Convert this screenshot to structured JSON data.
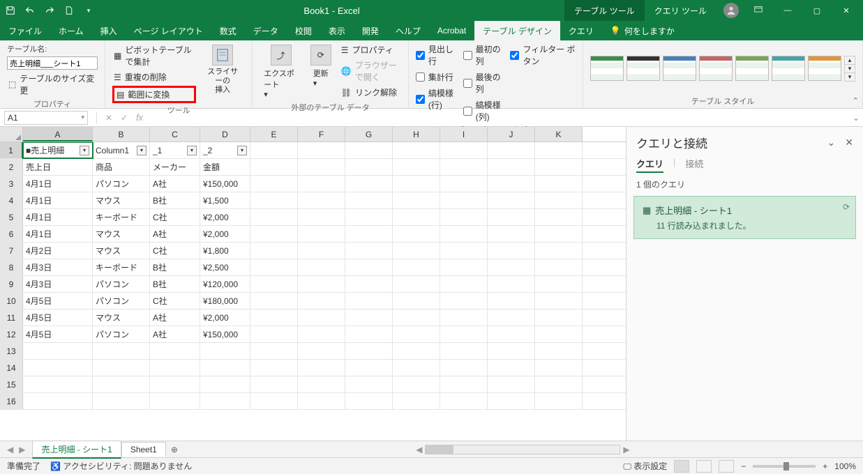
{
  "titlebar": {
    "title": "Book1  -  Excel"
  },
  "context_tabs": {
    "table": "テーブル ツール",
    "query": "クエリ ツール"
  },
  "ribbon_tabs": {
    "file": "ファイル",
    "home": "ホーム",
    "insert": "挿入",
    "layout": "ページ レイアウト",
    "formulas": "数式",
    "data": "データ",
    "review": "校閲",
    "view": "表示",
    "dev": "開発",
    "help": "ヘルプ",
    "acrobat": "Acrobat",
    "table_design": "テーブル デザイン",
    "query": "クエリ",
    "tell_me": "何をしますか"
  },
  "ribbon": {
    "props": {
      "label": "プロパティ",
      "table_name_label": "テーブル名:",
      "table_name_value": "売上明細___シート1",
      "resize": "テーブルのサイズ変更"
    },
    "tools": {
      "label": "ツール",
      "pivot": "ピボットテーブルで集計",
      "dedupe": "重複の削除",
      "convert": "範囲に変換",
      "slicer_top": "スライサーの",
      "slicer_bottom": "挿入"
    },
    "ext": {
      "label": "外部のテーブル データ",
      "export": "エクスポート",
      "refresh": "更新",
      "props": "プロパティ",
      "browser": "ブラウザーで開く",
      "unlink": "リンク解除"
    },
    "styleopts": {
      "label": "テーブル スタイルのオプション",
      "header": "見出し行",
      "first_col": "最初の列",
      "filter": "フィルター ボタン",
      "total": "集計行",
      "last_col": "最後の列",
      "banded_row": "縞模様 (行)",
      "banded_col": "縞模様 (列)"
    },
    "styles": {
      "label": "テーブル スタイル"
    }
  },
  "formula_bar": {
    "name_box": "A1"
  },
  "columns": [
    "A",
    "B",
    "C",
    "D",
    "E",
    "F",
    "G",
    "H",
    "I",
    "J",
    "K"
  ],
  "headers": {
    "a": "■売上明細",
    "b": "Column1",
    "c": "_1",
    "d": "_2"
  },
  "rows": [
    {
      "a": "売上日",
      "b": "商品",
      "c": "メーカー",
      "d": "金額"
    },
    {
      "a": "4月1日",
      "b": "パソコン",
      "c": "A社",
      "d": "¥150,000"
    },
    {
      "a": "4月1日",
      "b": "マウス",
      "c": "B社",
      "d": "¥1,500"
    },
    {
      "a": "4月1日",
      "b": "キーボード",
      "c": "C社",
      "d": "¥2,000"
    },
    {
      "a": "4月1日",
      "b": "マウス",
      "c": "A社",
      "d": "¥2,000"
    },
    {
      "a": "4月2日",
      "b": "マウス",
      "c": "C社",
      "d": "¥1,800"
    },
    {
      "a": "4月3日",
      "b": "キーボード",
      "c": "B社",
      "d": "¥2,500"
    },
    {
      "a": "4月3日",
      "b": "パソコン",
      "c": "B社",
      "d": "¥120,000"
    },
    {
      "a": "4月5日",
      "b": "パソコン",
      "c": "C社",
      "d": "¥180,000"
    },
    {
      "a": "4月5日",
      "b": "マウス",
      "c": "A社",
      "d": "¥2,000"
    },
    {
      "a": "4月5日",
      "b": "パソコン",
      "c": "A社",
      "d": "¥150,000"
    }
  ],
  "query_pane": {
    "title": "クエリと接続",
    "tab_query": "クエリ",
    "tab_conn": "接続",
    "count": "1 個のクエリ",
    "card_title": "売上明細 - シート1",
    "card_sub": "11 行読み込まれました。"
  },
  "sheet_tabs": {
    "tab1": "売上明細 - シート1",
    "tab2": "Sheet1"
  },
  "statusbar": {
    "ready": "準備完了",
    "accessibility": "アクセシビリティ: 問題ありません",
    "display": "表示設定",
    "zoom": "100%"
  }
}
